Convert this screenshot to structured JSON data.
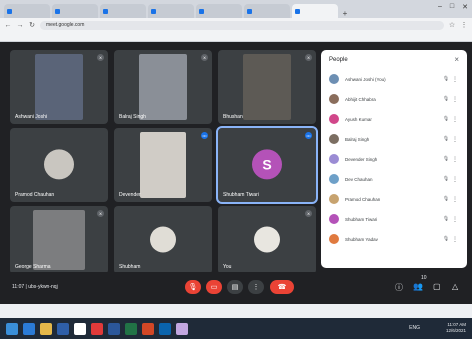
{
  "browser": {
    "tabs": [
      "",
      "",
      "",
      "",
      "",
      "",
      ""
    ],
    "url": "meet.google.com",
    "bookmarks": [
      "",
      "",
      "",
      "",
      "",
      "",
      ""
    ]
  },
  "tiles": [
    {
      "name": "Ashwani Joshi",
      "kind": "video",
      "video_color": "#5a6478"
    },
    {
      "name": "Balraj Singh",
      "kind": "video",
      "video_color": "#8a8f97"
    },
    {
      "name": "Bhushan",
      "kind": "video",
      "video_color": "#5d5a55"
    },
    {
      "name": "Pramod Chauhan",
      "kind": "avatar",
      "avatar_color": "#c9c6c0",
      "avatar_text": ""
    },
    {
      "name": "Devender",
      "kind": "video",
      "video_color": "#d0ccc6"
    },
    {
      "name": "Shubham Tiwari",
      "kind": "avatar",
      "avatar_color": "#b452b8",
      "avatar_text": "S"
    },
    {
      "name": "George Sharma",
      "kind": "video",
      "video_color": "#7c7d7f"
    },
    {
      "name": "Shubham",
      "kind": "avatar",
      "avatar_color": "#e0ddd6",
      "avatar_text": ""
    },
    {
      "name": "You",
      "kind": "avatar",
      "avatar_color": "#e8e6e0",
      "avatar_text": ""
    }
  ],
  "bottom": {
    "meeting_info": "11:07 | ubs-ykwn-nqj",
    "icons": [
      "mic-off-icon",
      "camera-off-icon",
      "captions-icon",
      "more-icon",
      "end-call-icon",
      "info-icon",
      "people-icon",
      "chat-icon",
      "activities-icon"
    ],
    "people_count": "10"
  },
  "panel": {
    "title": "People",
    "close": "×",
    "people": [
      {
        "name": "Ashwani Joshi (You)",
        "color": "#6d8fb3"
      },
      {
        "name": "Abhijit Chhabra",
        "color": "#8a6d5c"
      },
      {
        "name": "Ayush Kumar",
        "color": "#d1478a"
      },
      {
        "name": "Balraj Singh",
        "color": "#7b6e62"
      },
      {
        "name": "Devender Singh",
        "color": "#9b8cd4"
      },
      {
        "name": "Dev Chauhan",
        "color": "#6ea0c8"
      },
      {
        "name": "Pramod Chauhan",
        "color": "#c7a36f"
      },
      {
        "name": "Shubham Tiwari",
        "color": "#b452b8"
      },
      {
        "name": "Shubham Yadav",
        "color": "#e07a3f"
      }
    ]
  },
  "taskbar": {
    "icons": [
      "windows-icon",
      "edge-icon",
      "explorer-icon",
      "store-icon",
      "chrome-icon",
      "opera-icon",
      "word-icon",
      "excel-icon",
      "powerpoint-icon",
      "photos-icon",
      "paint-icon"
    ],
    "time": "11:07 AM",
    "date": "12/6/2021",
    "tray": "ENG"
  }
}
